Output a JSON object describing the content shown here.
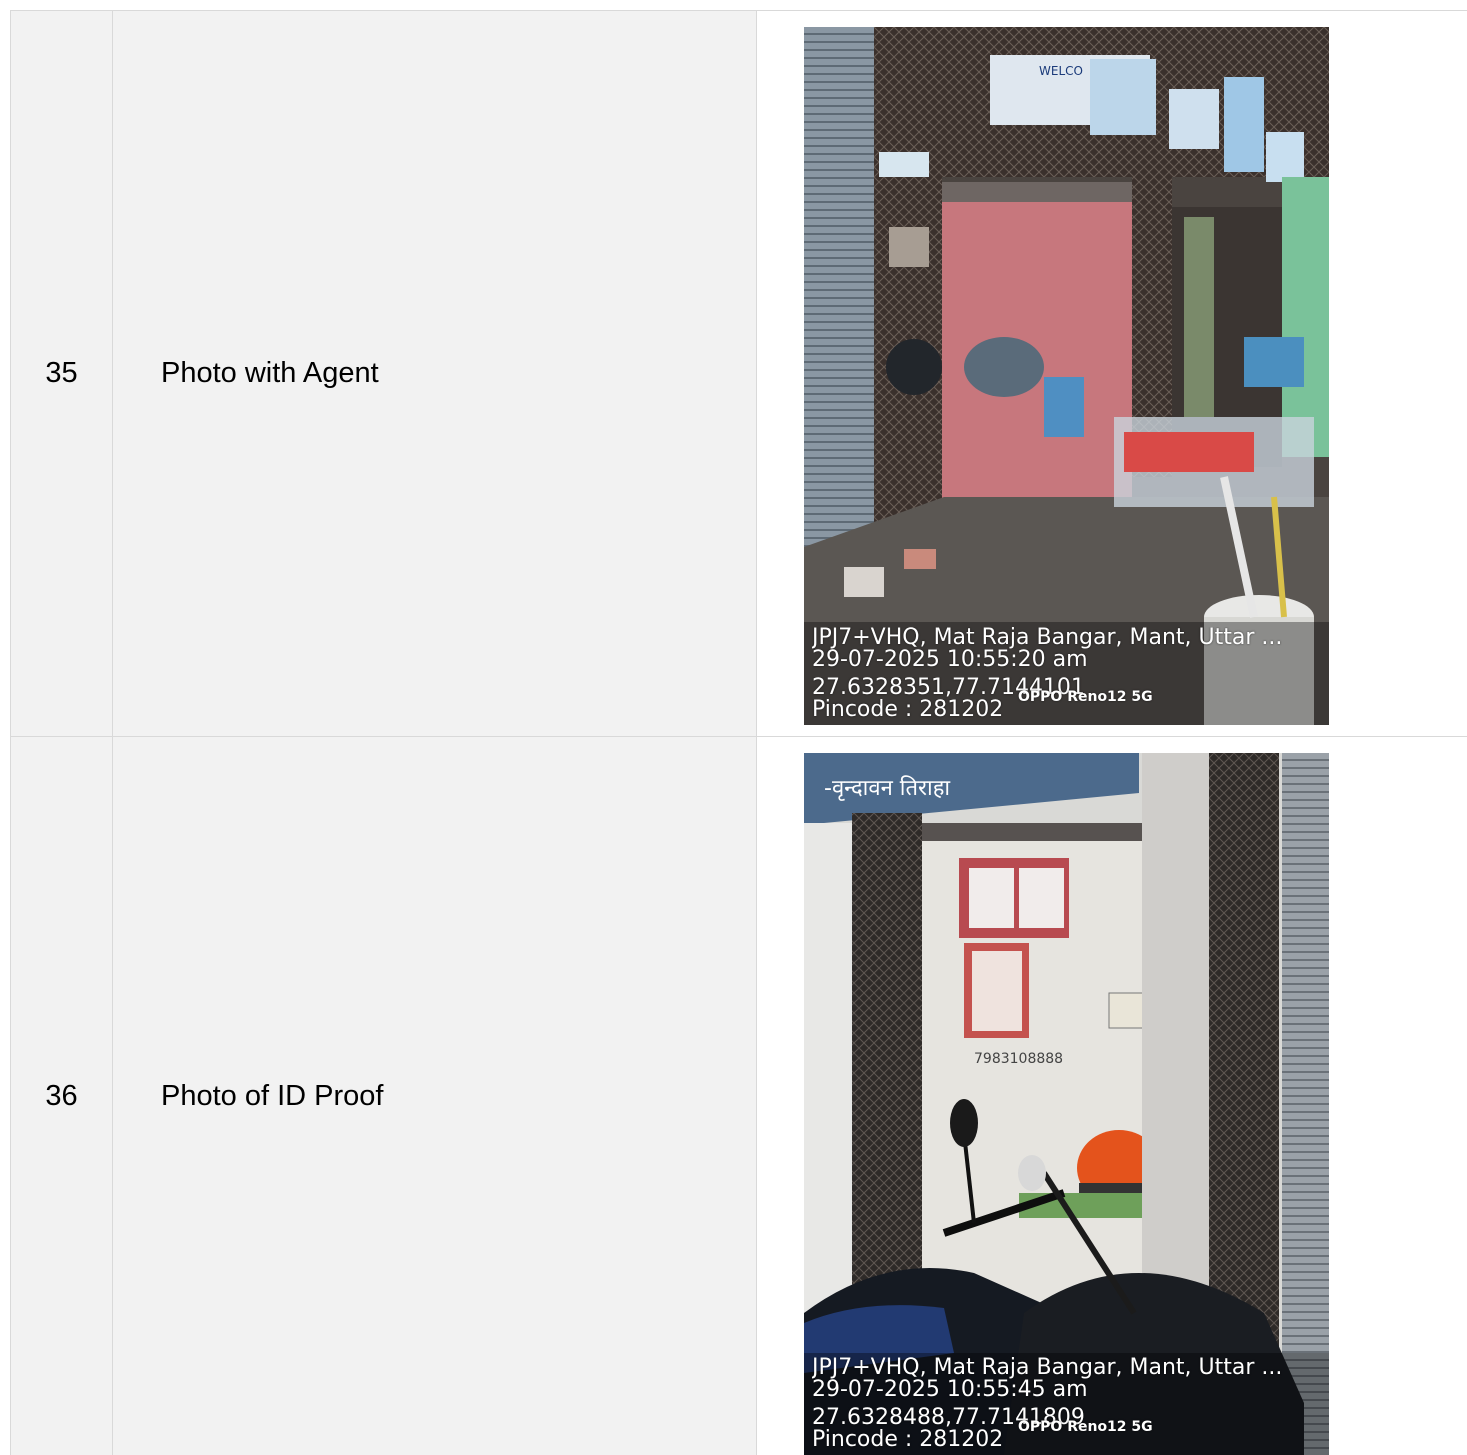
{
  "rows": [
    {
      "number": "35",
      "label": "Photo with Agent",
      "photo": {
        "address": "JPJ7+VHQ, Mat Raja Bangar, Mant, Uttar ...",
        "datetime": "29-07-2025 10:55:20 am",
        "coords": "27.6328351,77.7144101",
        "pincode": "Pincode : 281202",
        "device": "OPPO Reno12 5G",
        "sign_text": "WELCO"
      }
    },
    {
      "number": "36",
      "label": "Photo of ID Proof",
      "photo": {
        "address": "JPJ7+VHQ, Mat Raja Bangar, Mant, Uttar ...",
        "datetime": "29-07-2025 10:55:45 am",
        "coords": "27.6328488,77.7141809",
        "pincode": "Pincode : 281202",
        "device": "OPPO Reno12 5G",
        "banner_text": "-वृन्दावन तिराहा",
        "wall_text": "7983108888"
      }
    }
  ]
}
